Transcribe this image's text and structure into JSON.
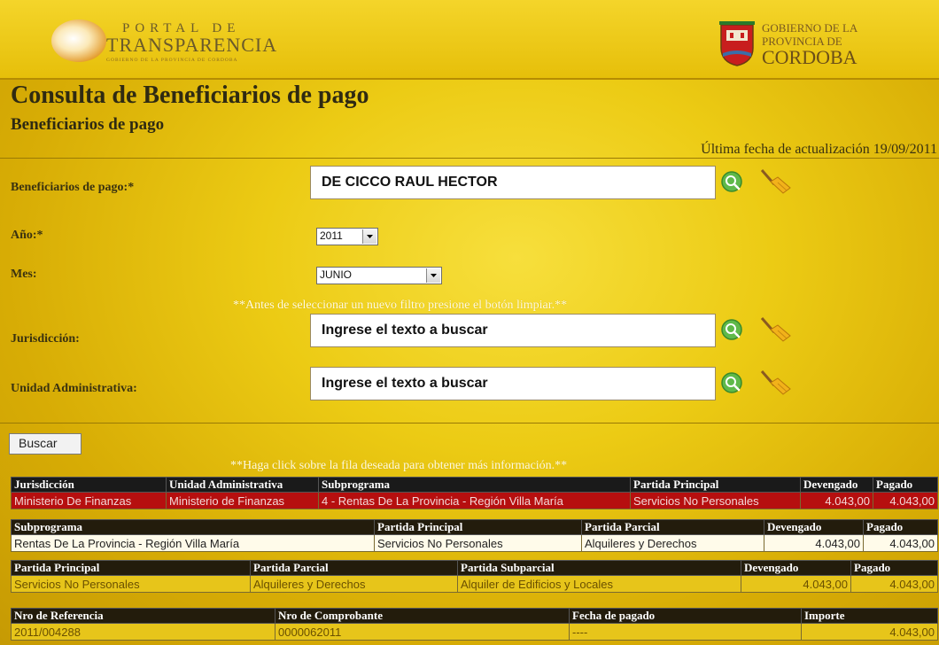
{
  "header": {
    "portal_line1": "PORTAL  DE",
    "portal_line2": "TRANSPARENCIA",
    "portal_line3": "GOBIERNO DE LA PROVINCIA DE CORDOBA",
    "gov_line1": "GOBIERNO DE LA",
    "gov_line2": "PROVINCIA DE",
    "gov_line3": "CORDOBA"
  },
  "page": {
    "title": "Consulta de Beneficiarios de pago",
    "subtitle": "Beneficiarios de pago",
    "last_update": "Última fecha de actualización 19/09/2011"
  },
  "form": {
    "beneficiario_label": "Beneficiarios de pago:*",
    "beneficiario_value": "DE CICCO RAUL HECTOR",
    "anio_label": "Año:*",
    "anio_value": "2011",
    "mes_label": "Mes:",
    "mes_value": "JUNIO",
    "filter_notice": "**Antes de seleccionar un nuevo filtro presione el botón limpiar.**",
    "jurisdiccion_label": "Jurisdicción:",
    "jurisdiccion_value": "Ingrese el texto a buscar",
    "unidad_label": "Unidad Administrativa:",
    "unidad_value": "Ingrese el texto a buscar",
    "buscar_label": "Buscar",
    "click_notice": "**Haga click sobre la fila deseada para obtener más información.**"
  },
  "icons": {
    "search": "search-icon",
    "clear": "broom-icon",
    "dropdown": "chevron-down-icon"
  },
  "colors": {
    "background": "#e8c20f",
    "header_row": "#1a1a1a",
    "selected_row": "#b60f0f",
    "highlight_row": "#e7c51a"
  },
  "table1": {
    "headers": [
      "Jurisdicción",
      "Unidad Administrativa",
      "Subprograma",
      "Partida Principal",
      "Devengado",
      "Pagado"
    ],
    "row": [
      "Ministerio De Finanzas",
      "Ministerio de Finanzas",
      "4 - Rentas De La Provincia - Región Villa María",
      "Servicios No Personales",
      "4.043,00",
      "4.043,00"
    ]
  },
  "table2": {
    "headers": [
      "Subprograma",
      "Partida Principal",
      "Partida Parcial",
      "Devengado",
      "Pagado"
    ],
    "row": [
      "Rentas De La Provincia - Región Villa María",
      "Servicios No Personales",
      "Alquileres y Derechos",
      "4.043,00",
      "4.043,00"
    ]
  },
  "table3": {
    "headers": [
      "Partida Principal",
      "Partida Parcial",
      "Partida Subparcial",
      "Devengado",
      "Pagado"
    ],
    "row": [
      "Servicios No Personales",
      "Alquileres y Derechos",
      "Alquiler de Edificios y Locales",
      "4.043,00",
      "4.043,00"
    ]
  },
  "table4": {
    "headers": [
      "Nro de Referencia",
      "Nro de Comprobante",
      "Fecha de pagado",
      "Importe"
    ],
    "row": [
      "2011/004288",
      "0000062011",
      "----",
      "4.043,00"
    ]
  }
}
